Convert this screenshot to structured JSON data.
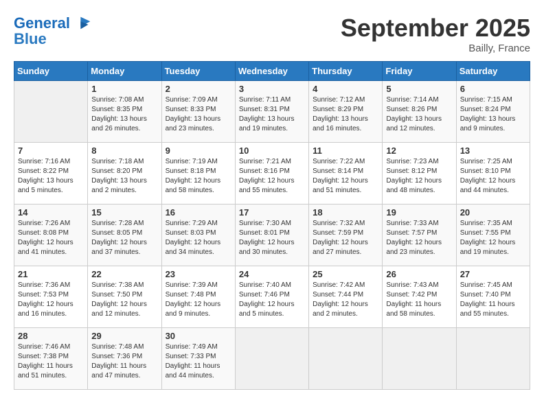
{
  "header": {
    "logo_line1": "General",
    "logo_line2": "Blue",
    "month": "September 2025",
    "location": "Bailly, France"
  },
  "days_of_week": [
    "Sunday",
    "Monday",
    "Tuesday",
    "Wednesday",
    "Thursday",
    "Friday",
    "Saturday"
  ],
  "weeks": [
    [
      {
        "day": "",
        "sunrise": "",
        "sunset": "",
        "daylight": ""
      },
      {
        "day": "1",
        "sunrise": "Sunrise: 7:08 AM",
        "sunset": "Sunset: 8:35 PM",
        "daylight": "Daylight: 13 hours and 26 minutes."
      },
      {
        "day": "2",
        "sunrise": "Sunrise: 7:09 AM",
        "sunset": "Sunset: 8:33 PM",
        "daylight": "Daylight: 13 hours and 23 minutes."
      },
      {
        "day": "3",
        "sunrise": "Sunrise: 7:11 AM",
        "sunset": "Sunset: 8:31 PM",
        "daylight": "Daylight: 13 hours and 19 minutes."
      },
      {
        "day": "4",
        "sunrise": "Sunrise: 7:12 AM",
        "sunset": "Sunset: 8:29 PM",
        "daylight": "Daylight: 13 hours and 16 minutes."
      },
      {
        "day": "5",
        "sunrise": "Sunrise: 7:14 AM",
        "sunset": "Sunset: 8:26 PM",
        "daylight": "Daylight: 13 hours and 12 minutes."
      },
      {
        "day": "6",
        "sunrise": "Sunrise: 7:15 AM",
        "sunset": "Sunset: 8:24 PM",
        "daylight": "Daylight: 13 hours and 9 minutes."
      }
    ],
    [
      {
        "day": "7",
        "sunrise": "Sunrise: 7:16 AM",
        "sunset": "Sunset: 8:22 PM",
        "daylight": "Daylight: 13 hours and 5 minutes."
      },
      {
        "day": "8",
        "sunrise": "Sunrise: 7:18 AM",
        "sunset": "Sunset: 8:20 PM",
        "daylight": "Daylight: 13 hours and 2 minutes."
      },
      {
        "day": "9",
        "sunrise": "Sunrise: 7:19 AM",
        "sunset": "Sunset: 8:18 PM",
        "daylight": "Daylight: 12 hours and 58 minutes."
      },
      {
        "day": "10",
        "sunrise": "Sunrise: 7:21 AM",
        "sunset": "Sunset: 8:16 PM",
        "daylight": "Daylight: 12 hours and 55 minutes."
      },
      {
        "day": "11",
        "sunrise": "Sunrise: 7:22 AM",
        "sunset": "Sunset: 8:14 PM",
        "daylight": "Daylight: 12 hours and 51 minutes."
      },
      {
        "day": "12",
        "sunrise": "Sunrise: 7:23 AM",
        "sunset": "Sunset: 8:12 PM",
        "daylight": "Daylight: 12 hours and 48 minutes."
      },
      {
        "day": "13",
        "sunrise": "Sunrise: 7:25 AM",
        "sunset": "Sunset: 8:10 PM",
        "daylight": "Daylight: 12 hours and 44 minutes."
      }
    ],
    [
      {
        "day": "14",
        "sunrise": "Sunrise: 7:26 AM",
        "sunset": "Sunset: 8:08 PM",
        "daylight": "Daylight: 12 hours and 41 minutes."
      },
      {
        "day": "15",
        "sunrise": "Sunrise: 7:28 AM",
        "sunset": "Sunset: 8:05 PM",
        "daylight": "Daylight: 12 hours and 37 minutes."
      },
      {
        "day": "16",
        "sunrise": "Sunrise: 7:29 AM",
        "sunset": "Sunset: 8:03 PM",
        "daylight": "Daylight: 12 hours and 34 minutes."
      },
      {
        "day": "17",
        "sunrise": "Sunrise: 7:30 AM",
        "sunset": "Sunset: 8:01 PM",
        "daylight": "Daylight: 12 hours and 30 minutes."
      },
      {
        "day": "18",
        "sunrise": "Sunrise: 7:32 AM",
        "sunset": "Sunset: 7:59 PM",
        "daylight": "Daylight: 12 hours and 27 minutes."
      },
      {
        "day": "19",
        "sunrise": "Sunrise: 7:33 AM",
        "sunset": "Sunset: 7:57 PM",
        "daylight": "Daylight: 12 hours and 23 minutes."
      },
      {
        "day": "20",
        "sunrise": "Sunrise: 7:35 AM",
        "sunset": "Sunset: 7:55 PM",
        "daylight": "Daylight: 12 hours and 19 minutes."
      }
    ],
    [
      {
        "day": "21",
        "sunrise": "Sunrise: 7:36 AM",
        "sunset": "Sunset: 7:53 PM",
        "daylight": "Daylight: 12 hours and 16 minutes."
      },
      {
        "day": "22",
        "sunrise": "Sunrise: 7:38 AM",
        "sunset": "Sunset: 7:50 PM",
        "daylight": "Daylight: 12 hours and 12 minutes."
      },
      {
        "day": "23",
        "sunrise": "Sunrise: 7:39 AM",
        "sunset": "Sunset: 7:48 PM",
        "daylight": "Daylight: 12 hours and 9 minutes."
      },
      {
        "day": "24",
        "sunrise": "Sunrise: 7:40 AM",
        "sunset": "Sunset: 7:46 PM",
        "daylight": "Daylight: 12 hours and 5 minutes."
      },
      {
        "day": "25",
        "sunrise": "Sunrise: 7:42 AM",
        "sunset": "Sunset: 7:44 PM",
        "daylight": "Daylight: 12 hours and 2 minutes."
      },
      {
        "day": "26",
        "sunrise": "Sunrise: 7:43 AM",
        "sunset": "Sunset: 7:42 PM",
        "daylight": "Daylight: 11 hours and 58 minutes."
      },
      {
        "day": "27",
        "sunrise": "Sunrise: 7:45 AM",
        "sunset": "Sunset: 7:40 PM",
        "daylight": "Daylight: 11 hours and 55 minutes."
      }
    ],
    [
      {
        "day": "28",
        "sunrise": "Sunrise: 7:46 AM",
        "sunset": "Sunset: 7:38 PM",
        "daylight": "Daylight: 11 hours and 51 minutes."
      },
      {
        "day": "29",
        "sunrise": "Sunrise: 7:48 AM",
        "sunset": "Sunset: 7:36 PM",
        "daylight": "Daylight: 11 hours and 47 minutes."
      },
      {
        "day": "30",
        "sunrise": "Sunrise: 7:49 AM",
        "sunset": "Sunset: 7:33 PM",
        "daylight": "Daylight: 11 hours and 44 minutes."
      },
      {
        "day": "",
        "sunrise": "",
        "sunset": "",
        "daylight": ""
      },
      {
        "day": "",
        "sunrise": "",
        "sunset": "",
        "daylight": ""
      },
      {
        "day": "",
        "sunrise": "",
        "sunset": "",
        "daylight": ""
      },
      {
        "day": "",
        "sunrise": "",
        "sunset": "",
        "daylight": ""
      }
    ]
  ]
}
